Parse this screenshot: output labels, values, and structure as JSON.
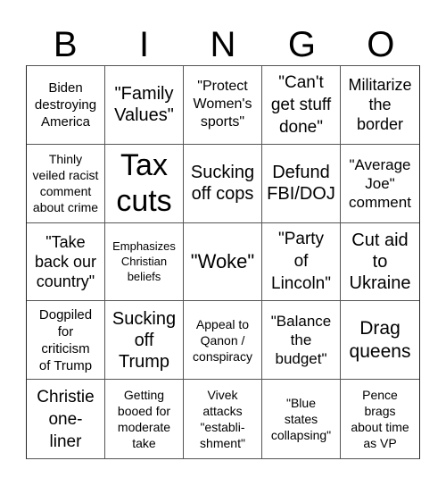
{
  "header": {
    "letters": [
      "B",
      "I",
      "N",
      "G",
      "O"
    ]
  },
  "cells": [
    "Biden\ndestroying\nAmerica",
    "\"Family\nValues\"",
    "\"Protect\nWomen's\nsports\"",
    "\"Can't\nget stuff\ndone\"",
    "Militarize\nthe\nborder",
    "Thinly\nveiled racist\ncomment\nabout crime",
    "Tax\ncuts",
    "Sucking\noff cops",
    "Defund\nFBI/DOJ",
    "\"Average\nJoe\"\ncomment",
    "\"Take\nback our\ncountry\"",
    "Emphasizes\nChristian\nbeliefs",
    "\"Woke\"",
    "\"Party\nof\nLincoln\"",
    "Cut aid\nto\nUkraine",
    "Dogpiled\nfor\ncriticism\nof Trump",
    "Sucking\noff\nTrump",
    "Appeal to\nQanon /\nconspiracy",
    "\"Balance\nthe\nbudget\"",
    "Drag\nqueens",
    "Christie\none-\nliner",
    "Getting\nbooed for\nmoderate\ntake",
    "Vivek\nattacks\n\"establi-\nshment\"",
    "\"Blue\nstates\ncollapsing\"",
    "Pence\nbrags\nabout time\nas VP"
  ]
}
